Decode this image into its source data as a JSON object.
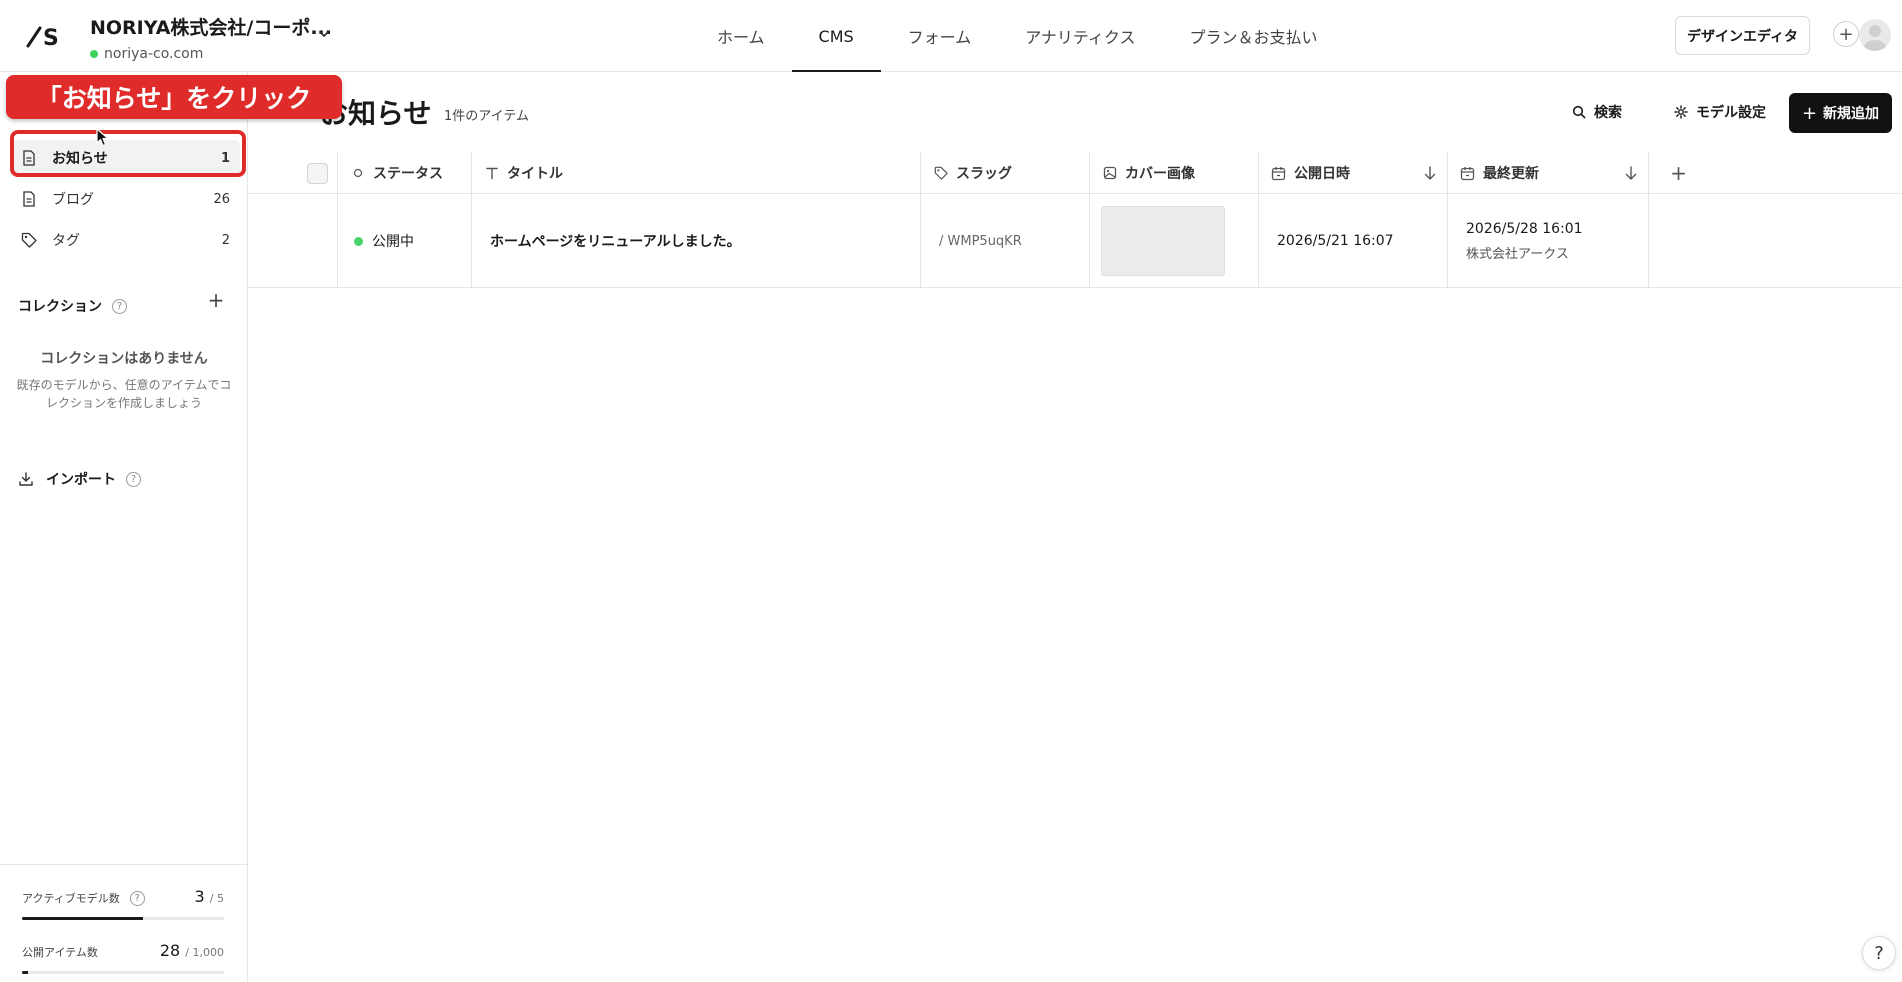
{
  "header": {
    "site_name": "NORIYA株式会社/コーポ...",
    "site_url": "noriya-co.com",
    "nav": [
      "ホーム",
      "CMS",
      "フォーム",
      "アナリティクス",
      "プラン＆お支払い"
    ],
    "nav_active": "CMS",
    "design_editor_label": "デザインエディタ",
    "plus_label": "+"
  },
  "sidebar": {
    "items": [
      {
        "label": "お知らせ",
        "count": "1",
        "icon": "document-icon"
      },
      {
        "label": "ブログ",
        "count": "26",
        "icon": "document-icon"
      },
      {
        "label": "タグ",
        "count": "2",
        "icon": "tag-icon"
      }
    ],
    "collections_title": "コレクション",
    "help_mark": "?",
    "add_label": "+",
    "empty_title": "コレクションはありません",
    "empty_desc": "既存のモデルから、任意のアイテムでコレクションを作成しましょう",
    "import_label": "インポート",
    "stats": [
      {
        "label": "アクティブモデル数",
        "value": "3",
        "max": "/ 5",
        "fraction": 0.6
      },
      {
        "label": "公開アイテム数",
        "value": "28",
        "max": "/ 1,000",
        "fraction": 0.028
      }
    ]
  },
  "main": {
    "title": "お知らせ",
    "item_count": "1件のアイテム",
    "search_label": "検索",
    "model_settings_label": "モデル設定",
    "new_label": "新規追加",
    "new_plus": "+",
    "columns": [
      "ステータス",
      "タイトル",
      "スラッグ",
      "カバー画像",
      "公開日時",
      "最終更新"
    ],
    "add_column_label": "+",
    "rows": [
      {
        "status": "公開中",
        "title": "ホームページをリニューアルしました。",
        "slug": "/ WMP5uqKR",
        "published": "2026/5/21 16:07",
        "updated": "2026/5/28 16:01",
        "updated_by": "株式会社アークス"
      }
    ]
  },
  "annotation": {
    "callout_text": "「お知らせ」をクリック"
  },
  "help_fab": "?",
  "colors": {
    "accent_red": "#e02b2b",
    "status_green": "#49d46a",
    "primary_button": "#111111"
  }
}
